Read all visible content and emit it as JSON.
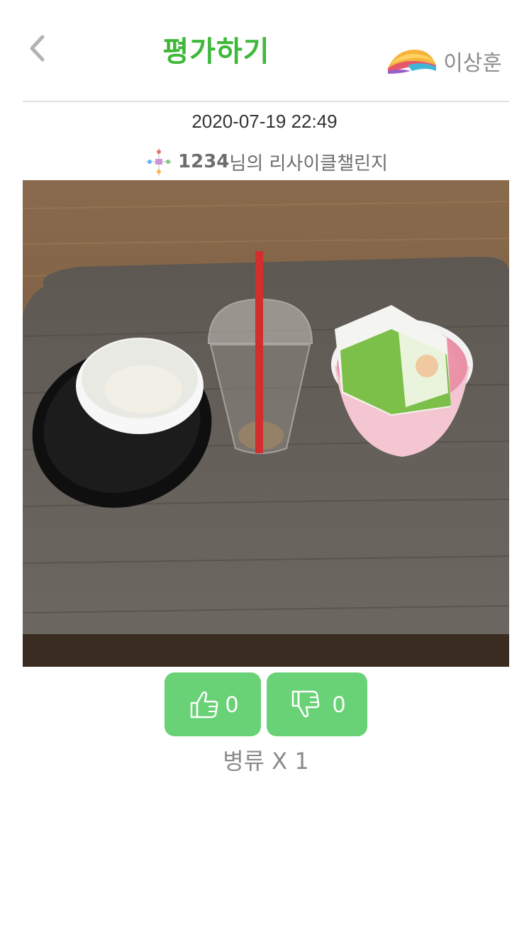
{
  "header": {
    "title": "평가하기",
    "user_name": "이상훈",
    "back_icon": "chevron-left-icon",
    "title_color": "#3fb83a"
  },
  "post": {
    "datetime": "2020-07-19 22:49",
    "author_id": "1234",
    "author_suffix": "님의 리사이클챌린지",
    "photo_description": "photo of empty plastic food containers, a clear plastic cup with a red straw, and a cup with a milk carton on a wooden table"
  },
  "votes": {
    "like_count": "0",
    "dislike_count": "0",
    "like_icon": "thumbs-up-icon",
    "dislike_icon": "thumbs-down-icon",
    "button_color": "#69d176"
  },
  "summary": {
    "text": "병류 X 1"
  }
}
